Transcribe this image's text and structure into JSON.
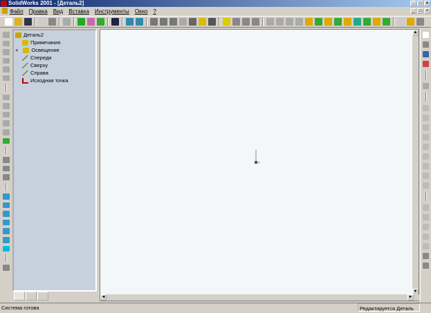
{
  "window": {
    "title": "SolidWorks 2001 - [Деталь2]",
    "logo": "SW"
  },
  "menu": [
    "Файл",
    "Правка",
    "Вид",
    "Вставка",
    "Инструменты",
    "Окно",
    "?"
  ],
  "tree": {
    "root": "Деталь2",
    "items": [
      "Примечания",
      "Освещение",
      "Спереди",
      "Сверху",
      "Справа",
      "Исходная точка"
    ],
    "expander": "+"
  },
  "status": {
    "left": "Система готова",
    "right": "Редактируется Деталь"
  },
  "colors": {
    "title_start": "#0a246a",
    "tree_bg": "#c6d1dd",
    "canvas_bg": "#f4f7f9"
  }
}
